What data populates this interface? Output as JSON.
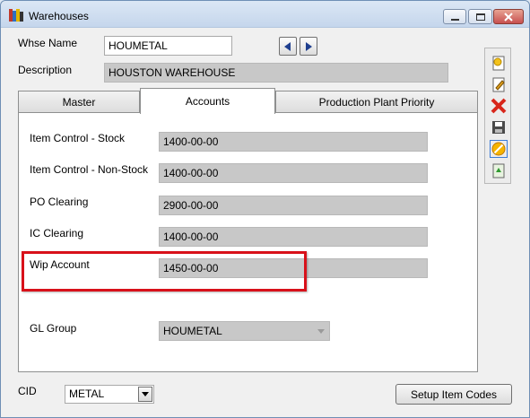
{
  "window": {
    "title": "Warehouses"
  },
  "header": {
    "whse_name_label": "Whse Name",
    "whse_name_value": "HOUMETAL",
    "description_label": "Description",
    "description_value": "HOUSTON WAREHOUSE"
  },
  "tabs": [
    {
      "label": "Master",
      "active": false
    },
    {
      "label": "Accounts",
      "active": true
    },
    {
      "label": "Production Plant Priority",
      "active": false
    }
  ],
  "accounts": {
    "rows": [
      {
        "label": "Item Control - Stock",
        "value": "1400-00-00"
      },
      {
        "label": "Item Control - Non-Stock",
        "value": "1400-00-00"
      },
      {
        "label": "PO Clearing",
        "value": "2900-00-00"
      },
      {
        "label": "IC Clearing",
        "value": "1400-00-00"
      },
      {
        "label": "Wip Account",
        "value": "1450-00-00"
      }
    ],
    "gl_group_label": "GL Group",
    "gl_group_value": "HOUMETAL"
  },
  "footer": {
    "cid_label": "CID",
    "cid_value": "METAL",
    "setup_button": "Setup Item Codes"
  },
  "toolbar_icons": [
    "new-icon",
    "edit-icon",
    "delete-icon",
    "save-icon",
    "cancel-icon",
    "refresh-icon"
  ],
  "colors": {
    "highlight": "#d8111a",
    "readonly_field": "#c8c8c8"
  }
}
